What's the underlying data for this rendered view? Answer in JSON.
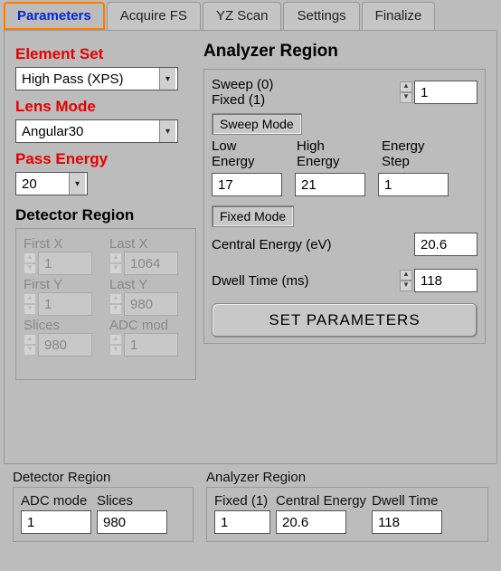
{
  "tabs": {
    "parameters": "Parameters",
    "acquire_fs": "Acquire FS",
    "yz_scan": "YZ Scan",
    "settings": "Settings",
    "finalize": "Finalize"
  },
  "left": {
    "element_set_label": "Element Set",
    "element_set_value": "High Pass (XPS)",
    "lens_mode_label": "Lens Mode",
    "lens_mode_value": "Angular30",
    "pass_energy_label": "Pass Energy",
    "pass_energy_value": "20",
    "detector_region_label": "Detector Region",
    "first_x_label": "First X",
    "first_x_value": "1",
    "last_x_label": "Last X",
    "last_x_value": "1064",
    "first_y_label": "First Y",
    "first_y_value": "1",
    "last_y_label": "Last Y",
    "last_y_value": "980",
    "slices_label": "Slices",
    "slices_value": "980",
    "adc_mode_label": "ADC mod",
    "adc_mode_value": "1"
  },
  "right": {
    "analyzer_region_label": "Analyzer Region",
    "sweep_label": "Sweep (0)",
    "fixed_label": "Fixed   (1)",
    "sweep_fixed_value": "1",
    "sweep_mode_btn": "Sweep Mode",
    "low_energy_label": "Low Energy",
    "low_energy_value": "17",
    "high_energy_label": "High Energy",
    "high_energy_value": "21",
    "energy_step_label": "Energy Step",
    "energy_step_value": "1",
    "fixed_mode_btn": "Fixed Mode",
    "central_energy_label": "Central Energy (eV)",
    "central_energy_value": "20.6",
    "dwell_time_label": "Dwell Time (ms)",
    "dwell_time_value": "118",
    "set_parameters_btn": "SET PARAMETERS"
  },
  "summary": {
    "detector_region_label": "Detector Region",
    "analyzer_region_label": "Analyzer Region",
    "adc_mode_label": "ADC mode",
    "adc_mode_value": "1",
    "slices_label": "Slices",
    "slices_value": "980",
    "fixed_label": "Fixed (1)",
    "fixed_value": "1",
    "central_energy_label": "Central Energy",
    "central_energy_value": "20.6",
    "dwell_time_label": "Dwell Time",
    "dwell_time_value": "118"
  }
}
